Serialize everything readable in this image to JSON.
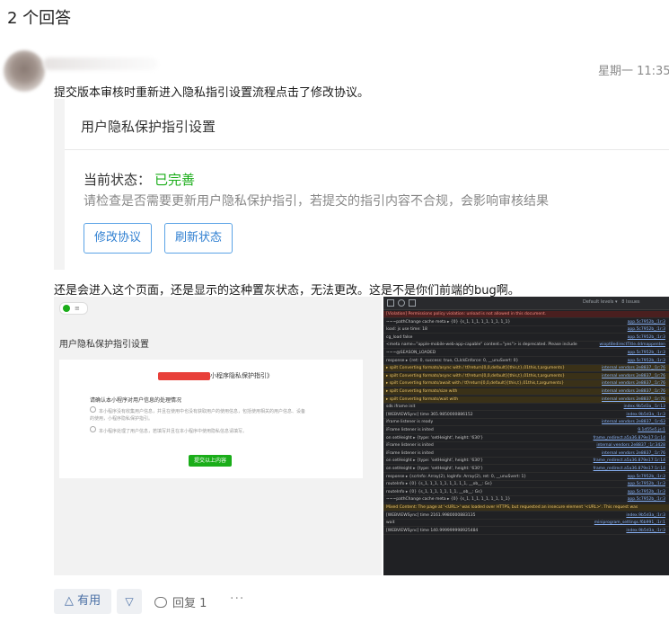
{
  "answer_count": "2 个回答",
  "answer": {
    "timestamp": "星期一 11:35",
    "text1": "提交版本审核时重新进入隐私指引设置流程点击了修改协议。",
    "text2": "还是会进入这个页面，还是显示的这种置灰状态，无法更改。这是不是你们前端的bug啊。"
  },
  "card1": {
    "title": "用户隐私保护指引设置",
    "status_label": "当前状态：",
    "status_value": "已完善",
    "description": "请检查是否需要更新用户隐私保护指引，若提交的指引内容不合规，会影响审核结果",
    "btn_modify": "修改协议",
    "btn_refresh": "刷新状态",
    "status_color": "#1aad19"
  },
  "shot2": {
    "page_title": "用户隐私保护指引设置",
    "heading_suffix": "小程序隐私保护指引》",
    "question": "请确认本小程序对用户信息的处理情况",
    "option1": "本小程序没有收集用户信息，并且在使用中也没有获取用户的使用信息，包括使用相关的用户信息、设备的使用，小程序隐私保护指引。",
    "option2": "本小程序处理了用户信息，若填写并且在本小程序中使用隐私信息请填写。",
    "button": "提交以上内容"
  },
  "devtools": {
    "level": "Default levels",
    "issues": "8 Issues",
    "rows": [
      {
        "type": "err",
        "text": "[Violation] Permissions policy violation: unload is not allowed in this document.",
        "src": ""
      },
      {
        "type": "",
        "text": "~~~pathChange cache meta  ▸ {0} {s_1, 1_1, 1_1, 1_1, 1_1}",
        "src": "app.5c7952b_:1r:3"
      },
      {
        "type": "",
        "text": "load: js use time: 18",
        "src": "app.5c7952b_:1r:3"
      },
      {
        "type": "",
        "text": "cg_load false",
        "src": "app.5c7952b_:1r:3"
      },
      {
        "type": "",
        "text": "<meta name=\"apple-mobile-web-app-capable\" content=\"yes\"> is deprecated. Please include",
        "src": "wiopt8edirectTitle.ddmappenten"
      },
      {
        "type": "",
        "text": "~~~@SEASON_LOADED",
        "src": "app.5c7952b_:1r:3"
      },
      {
        "type": "",
        "text": "response  ▸ {ret: 0, success: true, CLIckEnforce: 0, __unuSvert: 0}",
        "src": "app.5c7952b_:1r:3"
      },
      {
        "type": "warn",
        "text": "▸ spilt Converting formats/async with / tf/return[0,0,default]{this,t},01this,t,arguments}",
        "src": "internal vendors 2e8837_:1r:76"
      },
      {
        "type": "warn",
        "text": "▸ spilt Converting formats/async with / tf/return[0,0,default]{this,t},01this,t,arguments}",
        "src": "internal vendors 2e8837_:1r:76"
      },
      {
        "type": "warn",
        "text": "▸ spilt Converting formats/await with / tf/return[0,0,default]{this,t},01this,t,arguments}",
        "src": "internal vendors 2e8837_:1r:76"
      },
      {
        "type": "warn",
        "text": "▸ spilt Converting formats/size with",
        "src": "internal vendors 2e8837_:1r:76"
      },
      {
        "type": "warn",
        "text": "▸ spilt Converting formats/wait with",
        "src": "internal vendors 2e8837_:1r:76"
      },
      {
        "type": "",
        "text": "sdk iframe init",
        "src": "index.9b5d3a_:1r:13"
      },
      {
        "type": "",
        "text": "[WEBVIEWSync] time 365.9850000886152",
        "src": "index.9b5d3a_:1r:3"
      },
      {
        "type": "",
        "text": "iframe listener is ready",
        "src": "internal vendors 2e8837_:1r:63"
      },
      {
        "type": "",
        "text": "iFrame listener is inited",
        "src": "9.1d55e5.js:1"
      },
      {
        "type": "",
        "text": "on setHeight  ▸ {type: 'setHeight', height: '630'}",
        "src": "frame_redirect.a5a36.879e17:1r:14"
      },
      {
        "type": "",
        "text": "iFrame listener is inited",
        "src": "internal vendors 2e8837_:1r:3428"
      },
      {
        "type": "",
        "text": "iFrame listener is inited",
        "src": "internal vendors 2e8837_:1r:76"
      },
      {
        "type": "",
        "text": "on setHeight  ▸ {type: 'setHeight', height: '630'}",
        "src": "frame_redirect.a5a36.879e17:1r:14"
      },
      {
        "type": "",
        "text": "on setHeight  ▸ {type: 'setHeight', height: '630'}",
        "src": "frame_redirect.a5a36.879e17:1r:14"
      },
      {
        "type": "",
        "text": "response  ▸ {scrInfo: Array(2), logInfo: Array(2), ret: 0, __unuSvert: 1}",
        "src": "app.5c7952b_:1r:3"
      },
      {
        "type": "",
        "text": "routeInfo  ▸ {0} {s_1, 1_1, 1_1, 1_1, 1_1, __ob__: Gs}",
        "src": "app.5c7952b_:1r:3"
      },
      {
        "type": "",
        "text": "routeInfo  ▸ {0} {s_1, 1_1, 1_1, 1_1, __ob__: Gs}",
        "src": "app.5c7952b_:1r:3"
      },
      {
        "type": "",
        "text": "~~~pathChange cache meta  ▸ {0} {s_1, 1_1, 1_1, 1_1, 1_1}",
        "src": "app.5c7952b_:1r:3"
      },
      {
        "type": "warn",
        "text": "Mixed Content: The page at '<URL>' was loaded over HTTPS, but requested an insecure element '<URL>'. This request was",
        "src": ""
      },
      {
        "type": "",
        "text": "[WEBVIEWSync] time 2161.9980000883135",
        "src": "index.9b5d3a_:1r:3"
      },
      {
        "type": "",
        "text": "wait",
        "src": "miniprogram_settings.f6b991_:1r:1"
      },
      {
        "type": "",
        "text": "[WEBVIEWSync] time 140.999999998925484",
        "src": "index.9b5d3a_:1r:3"
      }
    ]
  },
  "actions": {
    "upvote": "有用",
    "upvote_glyph": "△",
    "downvote_glyph": "▽",
    "reply": "回复 1",
    "more": "···"
  }
}
